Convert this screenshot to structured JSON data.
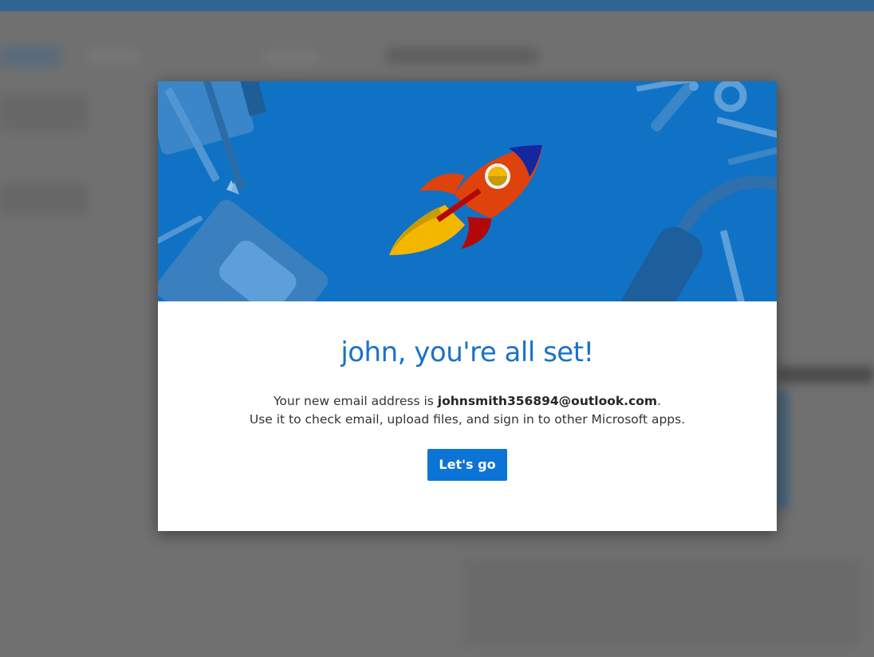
{
  "modal": {
    "title": "john, you're all set!",
    "line1_prefix": "Your new email address is ",
    "email": "johnsmith356894@outlook.com",
    "line1_suffix": ".",
    "line2": "Use it to check email, upload files, and sign in to other Microsoft apps.",
    "button_label": "Let's go"
  },
  "colors": {
    "hero_background": "#1072c5",
    "title": "#1a72c6",
    "button": "#0c74d6",
    "overlay": "#707070"
  },
  "icons": {
    "hero": "rocket-icon",
    "decorations": [
      "pencil-icon",
      "notebook-icon",
      "scissors-icon",
      "headphones-icon",
      "pen-icon"
    ]
  }
}
